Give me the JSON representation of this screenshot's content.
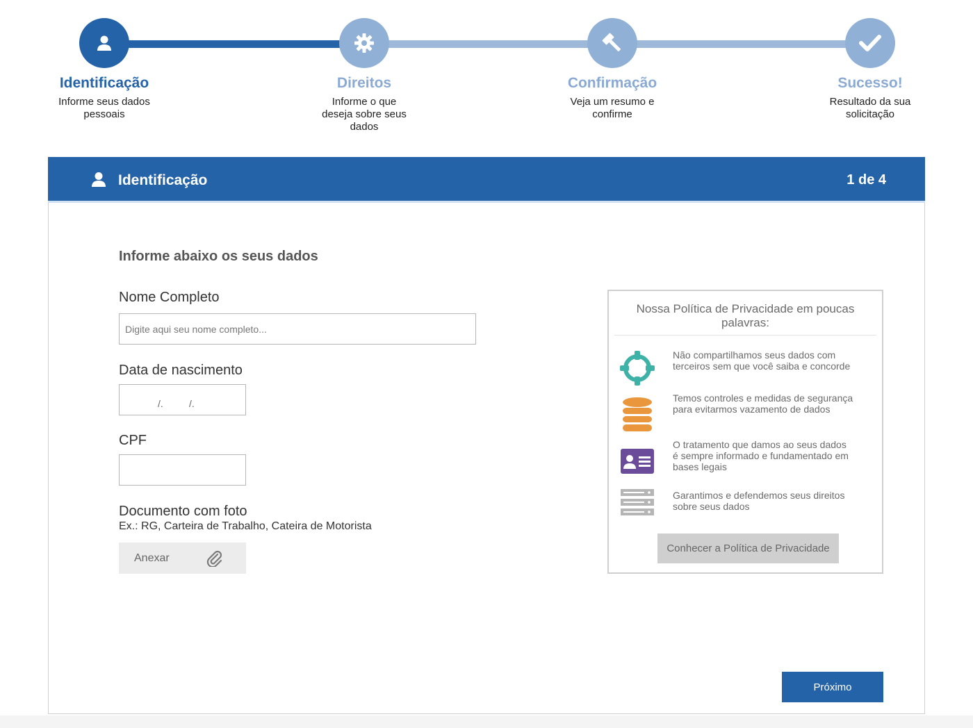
{
  "stepper": {
    "steps": [
      {
        "title": "Identificação",
        "desc_lines": [
          "Informe seus dados",
          "pessoais"
        ],
        "icon": "user-icon",
        "active": true
      },
      {
        "title": "Direitos",
        "desc_lines": [
          "Informe o que",
          "deseja sobre seus",
          "dados"
        ],
        "icon": "gear-icon",
        "active": false
      },
      {
        "title": "Confirmação",
        "desc_lines": [
          "Veja um resumo e",
          "confirme"
        ],
        "icon": "gavel-icon",
        "active": false
      },
      {
        "title": "Sucesso!",
        "desc_lines": [
          "Resultado da sua",
          "solicitação"
        ],
        "icon": "check-icon",
        "active": false
      }
    ]
  },
  "header": {
    "title": "Identificação",
    "counter": "1 de 4",
    "icon": "user-icon"
  },
  "form": {
    "heading": "Informe abaixo os seus dados",
    "name_label": "Nome Completo",
    "name_placeholder": "Digite aqui seu nome completo...",
    "name_value": "",
    "birth_label": "Data de nascimento",
    "birth_sep": "/.",
    "cpf_label": "CPF",
    "cpf_value": "",
    "doc_label": "Documento com foto",
    "doc_hint": "Ex.: RG, Carteira de Trabalho, Cateira de Motorista",
    "attach_label": "Anexar",
    "attach_icon": "paperclip-icon"
  },
  "privacy": {
    "title": "Nossa Política de Privacidade em poucas palavras:",
    "items": [
      {
        "icon": "crosshair-icon",
        "color": "#3fb2a8",
        "lines": [
          "Não compartilhamos seus dados com",
          "terceiros sem que você saiba e concorde"
        ]
      },
      {
        "icon": "database-icon",
        "color": "#e9963d",
        "lines": [
          "Temos controles e medidas de segurança",
          "para evitarmos vazamento de dados"
        ]
      },
      {
        "icon": "id-card-icon",
        "color": "#6b4c9a",
        "lines": [
          "O tratamento que damos ao seus dados",
          "é sempre informado e fundamentado em",
          "bases legais"
        ]
      },
      {
        "icon": "server-icon",
        "color": "#a9a9a9",
        "lines": [
          "Garantimos e defendemos seus direitos",
          "sobre seus dados"
        ]
      }
    ],
    "button_label": "Conhecer a Política de Privacidade"
  },
  "footer": {
    "next_label": "Próximo"
  },
  "colors": {
    "primary": "#2563a8",
    "inactive": "#90b0d6"
  }
}
